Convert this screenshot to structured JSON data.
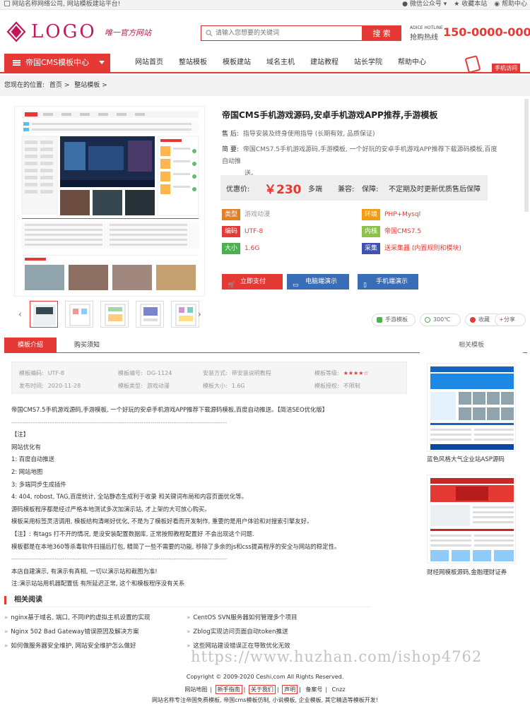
{
  "topbar": {
    "welcome": "网站名称网络公司, 网站模板建站平台!",
    "wechat": "微信公众号",
    "favorite": "收藏本站",
    "help": "帮助中心"
  },
  "header": {
    "logo_text": "LOGO",
    "slogan": "唯一官方网站",
    "search_placeholder": "请输入您想要的关键词",
    "search_button": "搜 索",
    "hotline_en": "ADICE HOTLINE",
    "hotline_cn": "抢购热线",
    "hotline_number": "150-0000-0000"
  },
  "nav": {
    "category": "帝国CMS模板中心",
    "links": [
      "网站首页",
      "整站模板",
      "模板建站",
      "域名主机",
      "建站教程",
      "站长学院",
      "帮助中心"
    ],
    "mobile_label": "手机访问"
  },
  "breadcrumb": {
    "prefix": "您现在的位置:",
    "home": "首页",
    "sep": ">",
    "current": "整站模板",
    "sep2": ">"
  },
  "product": {
    "title": "帝国CMS手机游戏源码,安卓手机游戏APP推荐,手游模板",
    "aftersale_label": "售 后:",
    "aftersale": "指导安装及终身使用指导 (长期有效, 品质保证)",
    "summary_label": "简 要:",
    "summary_1": "帝国CMS7.5手机游戏源码,手游模板, 一个好玩的安卓手机游戏APP推荐下载源码模板,百度自动推",
    "summary_2": "送。",
    "price_label": "优惠价:",
    "price": "￥230",
    "end": "多端",
    "compat_label": "兼容:",
    "guarantee_label": "保障:",
    "guarantee": "不定期及时更新优质售后保障",
    "attrs": [
      {
        "tag": "类型",
        "value": "游戏动漫",
        "color": "#e67e22"
      },
      {
        "tag": "环境",
        "value": "PHP+Mysql",
        "color": "#f39c12"
      },
      {
        "tag": "编码",
        "value": "UTF-8",
        "color": "#e53935"
      },
      {
        "tag": "内核",
        "value": "帝国CMS7.5",
        "color": "#8bc34a"
      },
      {
        "tag": "大小",
        "value": "1.6G",
        "color": "#4caf50"
      },
      {
        "tag": "采集",
        "value": "送采集器 (内置规则和模块)",
        "color": "#3f51b5"
      }
    ],
    "buttons": {
      "buy": "立即支付",
      "pc_demo": "电脑端演示",
      "mobile_demo": "手机端演示"
    },
    "pills": {
      "tag": "手游模板",
      "temp": "300℃",
      "fav": "收藏",
      "share": "分享"
    }
  },
  "tabs": {
    "intro": "模板介绍",
    "notice": "购买须知",
    "related": "相关模板"
  },
  "specs": [
    [
      "模板编码:",
      "UTF-8"
    ],
    [
      "模板编号:",
      "DG-1124"
    ],
    [
      "安装方式:",
      "带安装说明教程"
    ],
    [
      "模板等级:",
      "★★★★☆"
    ],
    [
      "发布时间:",
      "2020-11-28"
    ],
    [
      "模板类型:",
      "游戏动漫"
    ],
    [
      "模板大小:",
      "1.6G"
    ],
    [
      "模板授权:",
      "不限制"
    ]
  ],
  "article": [
    "帝国CMS7.5手机游戏源码,手游模板, 一个好玩的安卓手机游戏APP推荐下载源码模板,百度自动推送。【简洁SEO优化版】",
    "-----------------------------------------------------------------------------------------------------",
    "【注】",
    "网站优化有",
    "1: 百度自动推送",
    "2: 网站地图",
    "3: 多端同步生成插件",
    "4: 404, robost, TAG,百度统计, 全站静态生成利于收录 和关键词布局和内容页面优化等。",
    "源码模板程序都是经过严格本地测试多次加演示站, 才上架的大可放心购买。",
    "模板采用标签灵活调用, 模板结构清晰好优化, 不是为了模板好看而开发制作, 重要的是用户体验和对搜索引擎友好。",
    "【注】: 有tags 打不开的情况, 是没安装配置数据库, 正常按照教程配置好 不会出现这个问题.",
    "模板都是在本地360等杀毒软件扫描后打包, 精简了一些不需要的功能, 移除了多余的js和css提高程序的安全与网站的稳定性。",
    "-----------------------------------------------------------------------------------------------------",
    "本店自建演示, 有演示有真相, 一切以演示站和截图为准!",
    "注:演示站站用机器配置低 有所延迟正常, 这个和模板程序没有关系"
  ],
  "related_reading": {
    "title": "相关阅读",
    "items": [
      "nginx基于域名, 端口, 不同IP的虚拟主机设置的实现",
      "CentOS SVN服务器如何管理多个项目",
      "Nginx 502 Bad Gateway错误原因及解决方案",
      "Zblog实现访问页面自动token推送",
      "如何做服务器安全维护, 网站安全维护怎么做好",
      "这些网站建设错误正在导致优化无效"
    ]
  },
  "sidebar": {
    "items": [
      {
        "caption": "蓝色风格大气企业站ASP源码"
      },
      {
        "caption": "财经网模板源码,金融理财证券"
      }
    ]
  },
  "footer": {
    "copyright": "Copyright © 2009-2020 Ceshi.com All Rights Reserved.",
    "links": [
      "网站地图",
      "新手指南",
      "关于我们",
      "声明",
      "备案号",
      "Cnzz"
    ],
    "bottom": "网站名称专注帝国免费模板, 帝国cms模板仿制, 小说模板, 企业模板, 其它精选等模板开发!"
  },
  "watermark": "https://www.huzhan.com/ishop4762"
}
